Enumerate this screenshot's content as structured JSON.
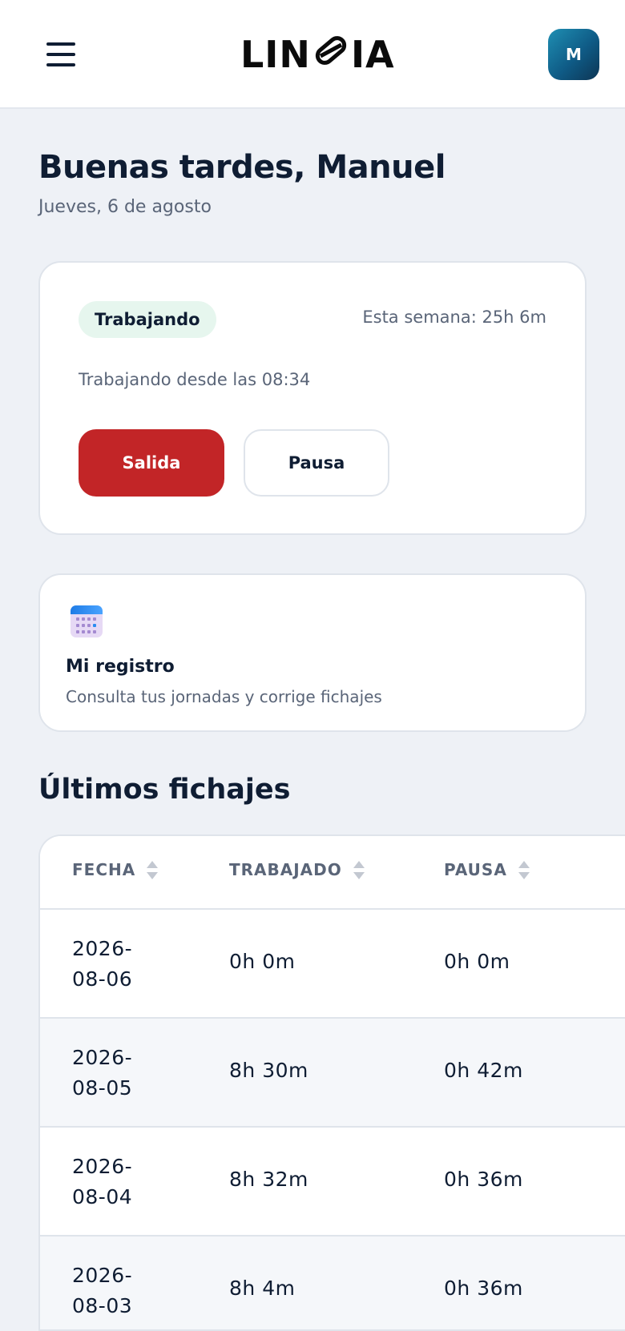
{
  "header": {
    "logo_text": "LIN IA",
    "logo_left": "LIN",
    "logo_right": "IA",
    "avatar_initial": "M",
    "menu_icon": "hamburger-menu-icon"
  },
  "greeting": {
    "title": "Buenas tardes, Manuel",
    "date": "Jueves, 6 de agosto"
  },
  "status_card": {
    "badge": "Trabajando",
    "week_summary": "Esta semana: 25h 6m",
    "since": "Trabajando desde las 08:34",
    "exit_button": "Salida",
    "pause_button": "Pausa",
    "colors": {
      "exit": "#c22527",
      "badge_bg": "#e6f6ee"
    }
  },
  "registro_card": {
    "icon": "calendar-icon",
    "title": "Mi registro",
    "subtitle": "Consulta tus jornadas y corrige fichajes"
  },
  "fichajes": {
    "title": "Últimos fichajes",
    "columns": [
      "FECHA",
      "TRABAJADO",
      "PAUSA"
    ],
    "rows": [
      {
        "fecha": "2026-08-06",
        "trabajado": "0h 0m",
        "pausa": "0h 0m"
      },
      {
        "fecha": "2026-08-05",
        "trabajado": "8h 30m",
        "pausa": "0h 42m"
      },
      {
        "fecha": "2026-08-04",
        "trabajado": "8h 32m",
        "pausa": "0h 36m"
      },
      {
        "fecha": "2026-08-03",
        "trabajado": "8h 4m",
        "pausa": "0h 36m"
      }
    ]
  }
}
